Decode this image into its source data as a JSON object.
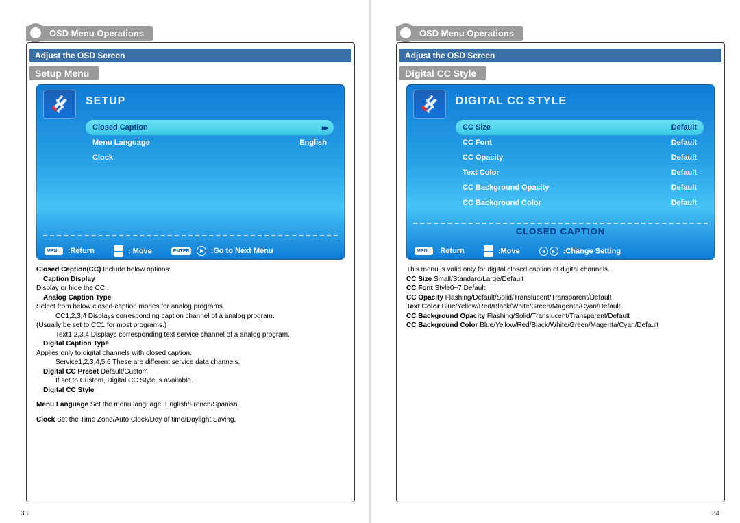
{
  "left": {
    "tab_title": "OSD Menu Operations",
    "blue_bar": "Adjust the OSD Screen",
    "gray_title": "Setup Menu",
    "osd": {
      "heading": "SETUP",
      "rows": [
        {
          "label": "Closed Caption",
          "value": "▸▸",
          "selected": true
        },
        {
          "label": "Menu Language",
          "value": "English",
          "selected": false
        },
        {
          "label": "Clock",
          "value": "",
          "selected": false
        }
      ],
      "foot_return": ":Return",
      "foot_move": ": Move",
      "foot_next": ":Go to Next Menu",
      "key_menu": "MENU",
      "key_enter": "ENTER"
    },
    "desc": {
      "l1b": "Closed Caption(CC)",
      "l1t": "  Include below options:",
      "l2b": "Caption Display",
      "l3": "Display or hide the CC .",
      "l4b": "Analog Caption Type",
      "l5": "Select from below closed-caption modes for analog programs.",
      "l6": "CC1,2,3,4  Displays corresponding caption channel of a analog program.",
      "l7": "(Usually be set to CC1 for most programs.)",
      "l8": "Text1,2,3,4  Displays corresponding text service channel of a analog program.",
      "l9b": "Digital Caption Type",
      "l10": "Applies only to digital channels with closed caption.",
      "l11": "Service1,2,3,4,5,6  These are different service data channels.",
      "l12b": "Digital CC Preset",
      "l12t": "  Default/Custom",
      "l13": "If set to Custom, Digital CC Style is available.",
      "l14b": "Digital CC Style",
      "l16b": "Menu Language",
      "l16t": "  Set the menu language. English/French/Spanish.",
      "l18b": "Clock",
      "l18t": " Set the Time Zone/Auto Clock/Day of time/Daylight Saving."
    },
    "page_number": "33"
  },
  "right": {
    "tab_title": "OSD Menu Operations",
    "blue_bar": "Adjust the OSD Screen",
    "gray_title": "Digital CC Style",
    "osd": {
      "heading": "DIGITAL CC STYLE",
      "rows": [
        {
          "label": "CC Size",
          "value": "Default",
          "selected": true
        },
        {
          "label": "CC Font",
          "value": "Default",
          "selected": false
        },
        {
          "label": "CC Opacity",
          "value": "Default",
          "selected": false
        },
        {
          "label": "Text Color",
          "value": "Default",
          "selected": false
        },
        {
          "label": "CC Background Opacity",
          "value": "Default",
          "selected": false
        },
        {
          "label": "CC Background Color",
          "value": "Default",
          "selected": false
        }
      ],
      "bottom_text": "CLOSED CAPTION",
      "foot_return": ":Return",
      "foot_move": ":Move",
      "foot_change": ":Change Setting",
      "key_menu": "MENU"
    },
    "desc": {
      "r1": "This menu is valid only for digital closed caption of digital channels.",
      "r2b": "CC Size",
      "r2t": "  Small/Standard/Large/Default",
      "r3b": "CC Font",
      "r3t": "  Style0~7,Default",
      "r4b": "CC Opacity",
      "r4t": "  Flashing/Default/Solid/Translucent/Transparent/Default",
      "r5b": "Text Color",
      "r5t": "  Blue/Yellow/Red/Black/White/Green/Magenta/Cyan/Default",
      "r6b": "CC Background Opacity",
      "r6t": "  Flashing/Solid/Translucent/Transparent/Default",
      "r7b": "CC Background Color",
      "r7t": "  Blue/Yellow/Red/Black/White/Green/Magenta/Cyan/Default"
    },
    "page_number": "34"
  }
}
